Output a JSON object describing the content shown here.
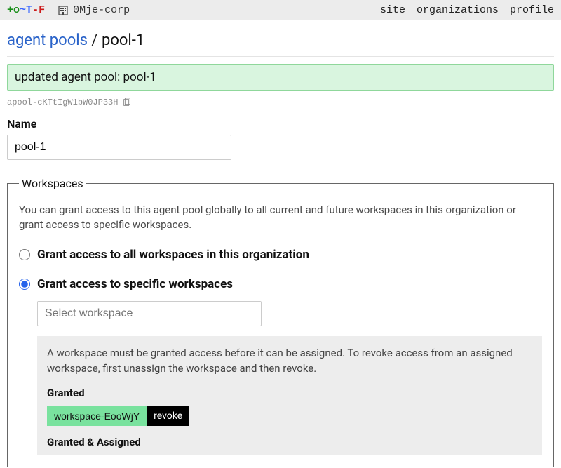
{
  "header": {
    "org_name": "0Mje-corp",
    "nav": {
      "site": "site",
      "organizations": "organizations",
      "profile": "profile"
    }
  },
  "breadcrumb": {
    "root": "agent pools",
    "sep": "/",
    "current": "pool-1"
  },
  "flash": "updated agent pool: pool-1",
  "pool_id": "apool-cKTtIgW1bW0JP33H",
  "name": {
    "label": "Name",
    "value": "pool-1"
  },
  "workspaces": {
    "legend": "Workspaces",
    "description": "You can grant access to this agent pool globally to all current and future workspaces in this organization or grant access to specific workspaces.",
    "option_all": "Grant access to all workspaces in this organization",
    "option_specific": "Grant access to specific workspaces",
    "select_placeholder": "Select workspace",
    "granted_note": "A workspace must be granted access before it can be assigned. To revoke access from an assigned workspace, first unassign the workspace and then revoke.",
    "granted_heading": "Granted",
    "granted_items": [
      {
        "name": "workspace-EooWjY",
        "action": "revoke"
      }
    ],
    "granted_assigned_heading": "Granted & Assigned"
  }
}
